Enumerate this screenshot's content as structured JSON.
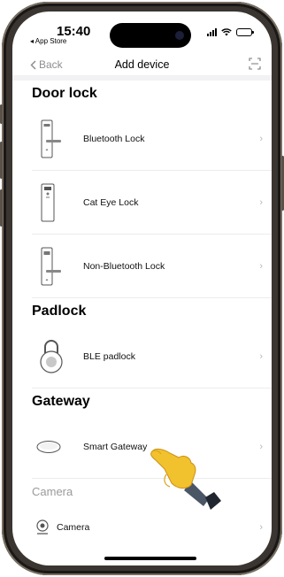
{
  "status_bar": {
    "time": "15:40",
    "back_app": "◂ App Store"
  },
  "nav": {
    "back_label": "Back",
    "title": "Add device"
  },
  "sections": {
    "door_lock": {
      "title": "Door lock",
      "items": [
        {
          "label": "Bluetooth Lock"
        },
        {
          "label": "Cat Eye Lock"
        },
        {
          "label": "Non-Bluetooth Lock"
        }
      ]
    },
    "padlock": {
      "title": "Padlock",
      "items": [
        {
          "label": "BLE padlock"
        }
      ]
    },
    "gateway": {
      "title": "Gateway",
      "items": [
        {
          "label": "Smart Gateway"
        }
      ]
    },
    "camera": {
      "title": "Camera",
      "items": [
        {
          "label": "Camera"
        }
      ]
    }
  },
  "icons": {
    "chevron": "chevron-right-icon",
    "scan": "scan-icon"
  }
}
